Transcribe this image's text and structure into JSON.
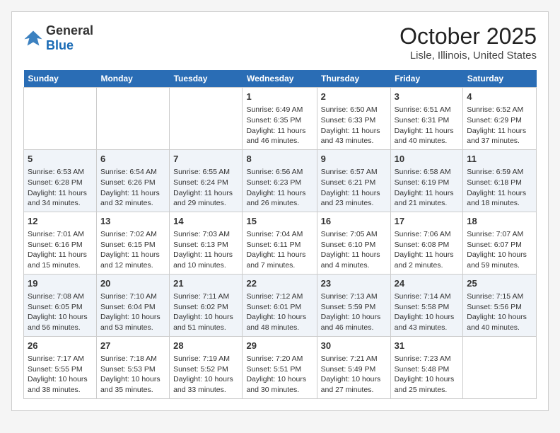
{
  "header": {
    "logo_general": "General",
    "logo_blue": "Blue",
    "month": "October 2025",
    "location": "Lisle, Illinois, United States"
  },
  "weekdays": [
    "Sunday",
    "Monday",
    "Tuesday",
    "Wednesday",
    "Thursday",
    "Friday",
    "Saturday"
  ],
  "weeks": [
    [
      {
        "day": "",
        "info": ""
      },
      {
        "day": "",
        "info": ""
      },
      {
        "day": "",
        "info": ""
      },
      {
        "day": "1",
        "info": "Sunrise: 6:49 AM\nSunset: 6:35 PM\nDaylight: 11 hours and 46 minutes."
      },
      {
        "day": "2",
        "info": "Sunrise: 6:50 AM\nSunset: 6:33 PM\nDaylight: 11 hours and 43 minutes."
      },
      {
        "day": "3",
        "info": "Sunrise: 6:51 AM\nSunset: 6:31 PM\nDaylight: 11 hours and 40 minutes."
      },
      {
        "day": "4",
        "info": "Sunrise: 6:52 AM\nSunset: 6:29 PM\nDaylight: 11 hours and 37 minutes."
      }
    ],
    [
      {
        "day": "5",
        "info": "Sunrise: 6:53 AM\nSunset: 6:28 PM\nDaylight: 11 hours and 34 minutes."
      },
      {
        "day": "6",
        "info": "Sunrise: 6:54 AM\nSunset: 6:26 PM\nDaylight: 11 hours and 32 minutes."
      },
      {
        "day": "7",
        "info": "Sunrise: 6:55 AM\nSunset: 6:24 PM\nDaylight: 11 hours and 29 minutes."
      },
      {
        "day": "8",
        "info": "Sunrise: 6:56 AM\nSunset: 6:23 PM\nDaylight: 11 hours and 26 minutes."
      },
      {
        "day": "9",
        "info": "Sunrise: 6:57 AM\nSunset: 6:21 PM\nDaylight: 11 hours and 23 minutes."
      },
      {
        "day": "10",
        "info": "Sunrise: 6:58 AM\nSunset: 6:19 PM\nDaylight: 11 hours and 21 minutes."
      },
      {
        "day": "11",
        "info": "Sunrise: 6:59 AM\nSunset: 6:18 PM\nDaylight: 11 hours and 18 minutes."
      }
    ],
    [
      {
        "day": "12",
        "info": "Sunrise: 7:01 AM\nSunset: 6:16 PM\nDaylight: 11 hours and 15 minutes."
      },
      {
        "day": "13",
        "info": "Sunrise: 7:02 AM\nSunset: 6:15 PM\nDaylight: 11 hours and 12 minutes."
      },
      {
        "day": "14",
        "info": "Sunrise: 7:03 AM\nSunset: 6:13 PM\nDaylight: 11 hours and 10 minutes."
      },
      {
        "day": "15",
        "info": "Sunrise: 7:04 AM\nSunset: 6:11 PM\nDaylight: 11 hours and 7 minutes."
      },
      {
        "day": "16",
        "info": "Sunrise: 7:05 AM\nSunset: 6:10 PM\nDaylight: 11 hours and 4 minutes."
      },
      {
        "day": "17",
        "info": "Sunrise: 7:06 AM\nSunset: 6:08 PM\nDaylight: 11 hours and 2 minutes."
      },
      {
        "day": "18",
        "info": "Sunrise: 7:07 AM\nSunset: 6:07 PM\nDaylight: 10 hours and 59 minutes."
      }
    ],
    [
      {
        "day": "19",
        "info": "Sunrise: 7:08 AM\nSunset: 6:05 PM\nDaylight: 10 hours and 56 minutes."
      },
      {
        "day": "20",
        "info": "Sunrise: 7:10 AM\nSunset: 6:04 PM\nDaylight: 10 hours and 53 minutes."
      },
      {
        "day": "21",
        "info": "Sunrise: 7:11 AM\nSunset: 6:02 PM\nDaylight: 10 hours and 51 minutes."
      },
      {
        "day": "22",
        "info": "Sunrise: 7:12 AM\nSunset: 6:01 PM\nDaylight: 10 hours and 48 minutes."
      },
      {
        "day": "23",
        "info": "Sunrise: 7:13 AM\nSunset: 5:59 PM\nDaylight: 10 hours and 46 minutes."
      },
      {
        "day": "24",
        "info": "Sunrise: 7:14 AM\nSunset: 5:58 PM\nDaylight: 10 hours and 43 minutes."
      },
      {
        "day": "25",
        "info": "Sunrise: 7:15 AM\nSunset: 5:56 PM\nDaylight: 10 hours and 40 minutes."
      }
    ],
    [
      {
        "day": "26",
        "info": "Sunrise: 7:17 AM\nSunset: 5:55 PM\nDaylight: 10 hours and 38 minutes."
      },
      {
        "day": "27",
        "info": "Sunrise: 7:18 AM\nSunset: 5:53 PM\nDaylight: 10 hours and 35 minutes."
      },
      {
        "day": "28",
        "info": "Sunrise: 7:19 AM\nSunset: 5:52 PM\nDaylight: 10 hours and 33 minutes."
      },
      {
        "day": "29",
        "info": "Sunrise: 7:20 AM\nSunset: 5:51 PM\nDaylight: 10 hours and 30 minutes."
      },
      {
        "day": "30",
        "info": "Sunrise: 7:21 AM\nSunset: 5:49 PM\nDaylight: 10 hours and 27 minutes."
      },
      {
        "day": "31",
        "info": "Sunrise: 7:23 AM\nSunset: 5:48 PM\nDaylight: 10 hours and 25 minutes."
      },
      {
        "day": "",
        "info": ""
      }
    ]
  ]
}
